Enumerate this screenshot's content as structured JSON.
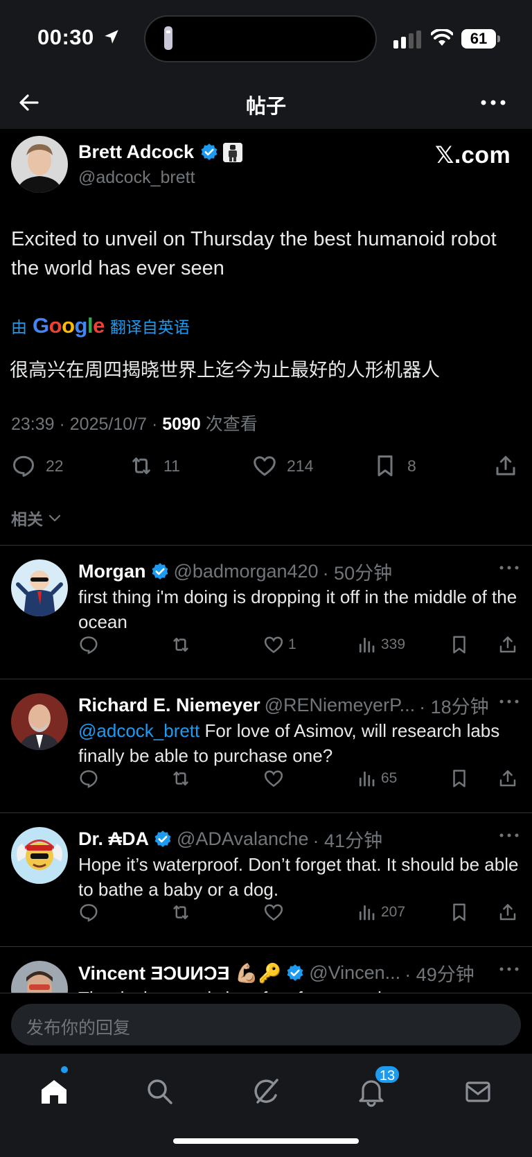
{
  "status_bar": {
    "time": "00:30",
    "battery": "61"
  },
  "header": {
    "title": "帖子"
  },
  "post": {
    "author_name": "Brett Adcock",
    "author_handle": "@adcock_brett",
    "brand": "𝕏.com",
    "text": "Excited to unveil on Thursday the best humanoid robot the world has ever seen",
    "translate_prefix": "由",
    "translate_google": "Google",
    "translate_suffix": "翻译自英语",
    "translated_text": "很高兴在周四揭晓世界上迄今为止最好的人形机器人",
    "meta_time": "23:39 · 2025/10/7 · ",
    "meta_views": "5090",
    "meta_views_label": " 次查看",
    "stats": {
      "replies": "22",
      "reposts": "11",
      "likes": "214",
      "bookmarks": "8"
    },
    "related_label": "相关"
  },
  "replies": [
    {
      "name": "Morgan",
      "handle": "@badmorgan420",
      "time": "· 50分钟",
      "text": "first thing i'm doing is dropping it off in the middle of the ocean",
      "likes": "1",
      "views": "339"
    },
    {
      "name": "Richard E. Niemeyer",
      "handle": "@RENiemeyerP...",
      "time": "· 18分钟",
      "mention": "@adcock_brett",
      "text": " For love of Asimov, will research labs finally be able to purchase one?",
      "likes": "",
      "views": "65"
    },
    {
      "name": "Dr. ₳DA",
      "handle": "@ADAvalanche",
      "time": "· 41分钟",
      "text": "Hope it’s waterproof. Don’t forget that. It should be able to bathe a baby or a dog.",
      "likes": "",
      "views": "207"
    },
    {
      "name": "Vincent ƎƆUИƆƎ 💪🏼🔑",
      "handle": "@Vincen...",
      "time": "· 49分钟",
      "text": "The device needs less feet for example"
    }
  ],
  "composer": {
    "placeholder": "发布你的回复"
  },
  "tabbar": {
    "notifications_badge": "13"
  },
  "colors": {
    "accent": "#1d9bf0",
    "background": "#000000",
    "muted": "#71767b"
  }
}
